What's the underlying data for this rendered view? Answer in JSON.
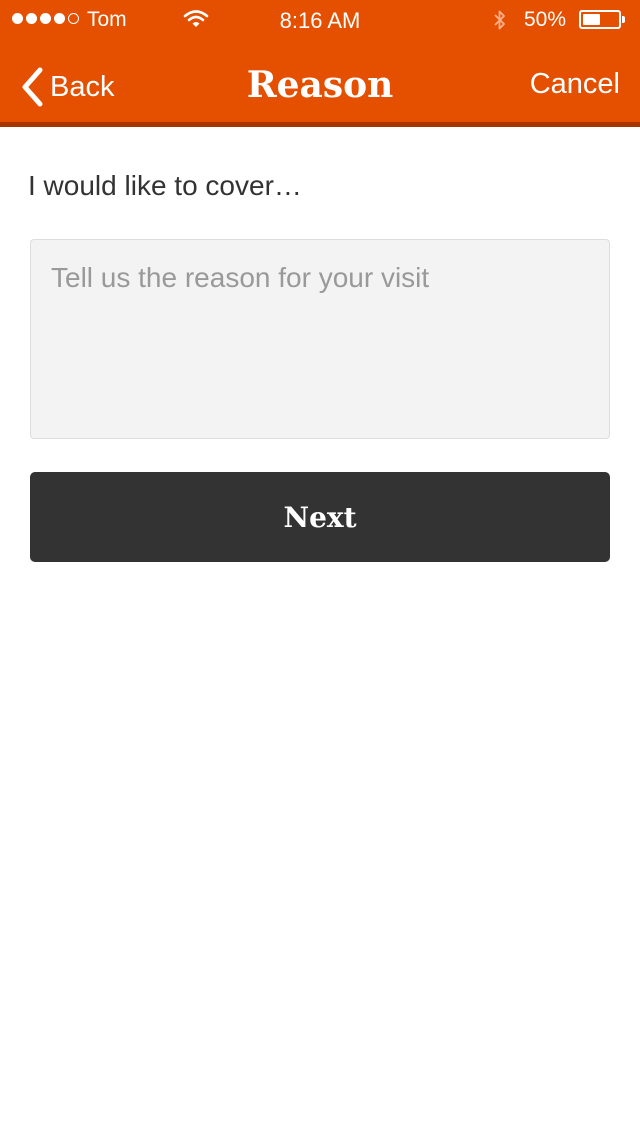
{
  "status_bar": {
    "signal_icon": "signal-dots-icon",
    "signal_bars": 4,
    "signal_bars_max": 5,
    "carrier": "Tom",
    "wifi_icon": "wifi-icon",
    "time": "8:16 AM",
    "bluetooth_icon": "bluetooth-icon",
    "battery_percent": "50%",
    "battery_level": 0.5
  },
  "nav": {
    "back_icon": "chevron-left-icon",
    "back_label": "Back",
    "title": "Reason",
    "cancel_label": "Cancel"
  },
  "form": {
    "prompt": "I would like to cover…",
    "reason_value": "",
    "reason_placeholder": "Tell us the reason for your visit",
    "next_label": "Next"
  },
  "colors": {
    "header": "#e45000",
    "header_shadow": "#a63500",
    "input_bg": "#f3f3f3",
    "button": "#333333"
  }
}
